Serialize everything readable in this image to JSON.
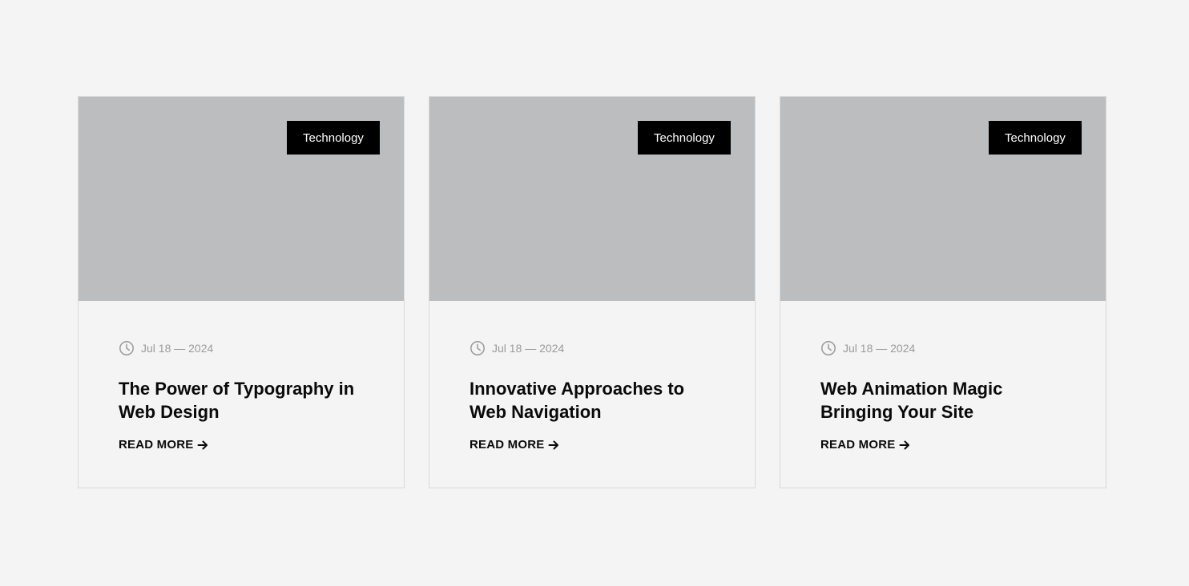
{
  "cards": [
    {
      "category": "Technology",
      "date": "Jul 18 — 2024",
      "title": "The Power of Typography in Web Design",
      "link_label": "READ MORE"
    },
    {
      "category": "Technology",
      "date": "Jul 18 — 2024",
      "title": "Innovative Approaches to Web Navigation",
      "link_label": "READ MORE"
    },
    {
      "category": "Technology",
      "date": "Jul 18 — 2024",
      "title": "Web Animation Magic Bringing Your Site",
      "link_label": "READ MORE"
    }
  ],
  "icons": {
    "date": "clock-icon",
    "link": "arrow-right-icon"
  },
  "colors": {
    "page_background": "#f4f4f4",
    "image_placeholder": "#bcbdbf",
    "badge_background": "#000000",
    "badge_text": "#ffffff",
    "meta_text": "#9a9a9a",
    "title_text": "#0a0a0a"
  }
}
